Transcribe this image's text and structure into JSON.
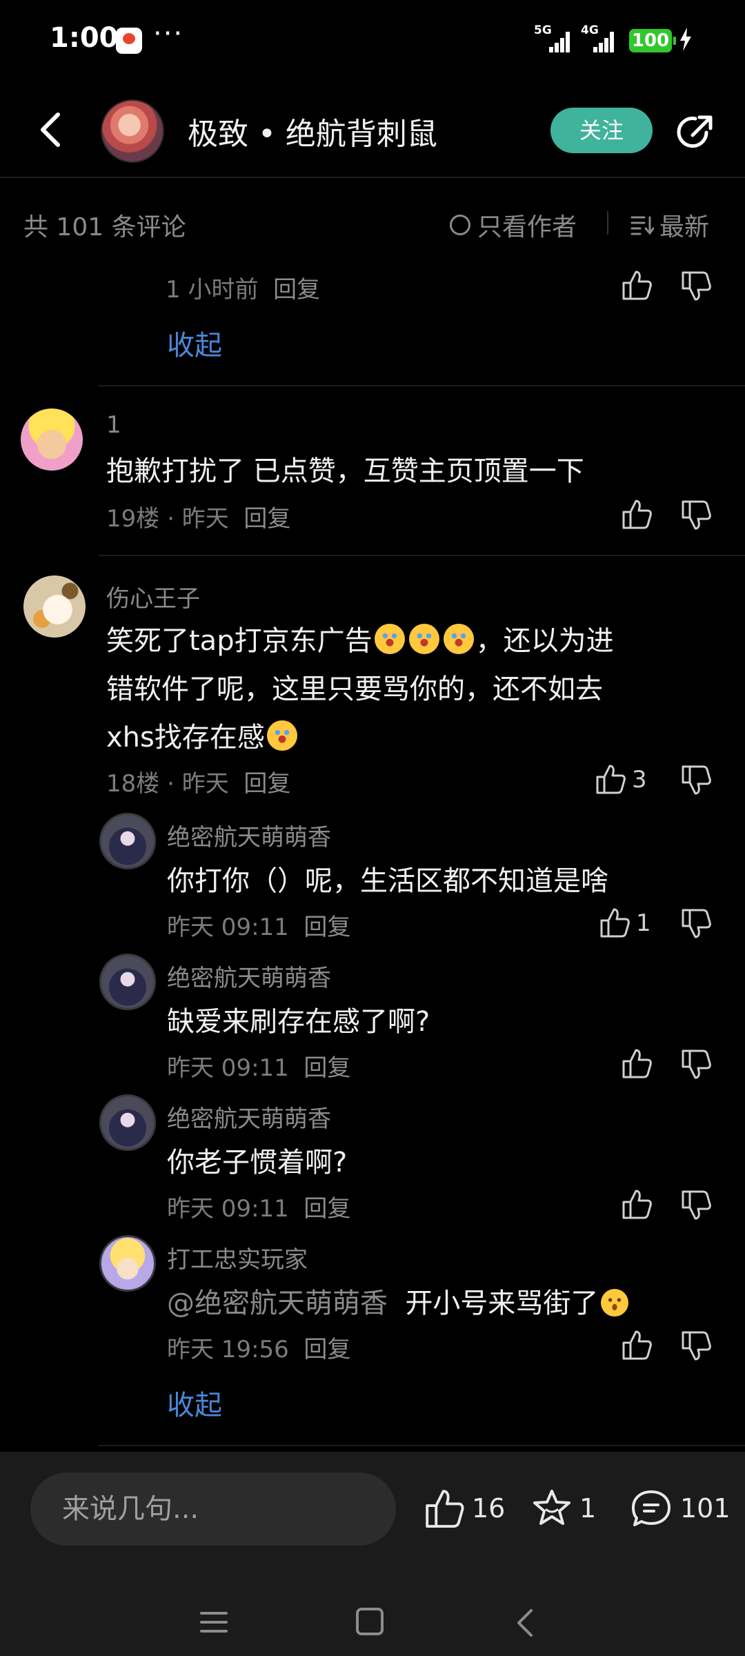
{
  "status_bar": {
    "time": "1:00",
    "dots": "···",
    "net1": "5G",
    "net2": "4G",
    "battery": "100"
  },
  "header": {
    "author_name": "极致 • 绝航背刺鼠",
    "follow_label": "关注"
  },
  "sub_header": {
    "total": "共 101 条评论",
    "author_only": "只看作者",
    "sort": "最新"
  },
  "thread_top": {
    "time": "1 小时前",
    "reply": "回复",
    "collapse": "收起"
  },
  "comments": [
    {
      "username": "1",
      "text": "抱歉打扰了 已点赞，互赞主页顶置一下",
      "floor": "19楼",
      "time": "昨天",
      "reply": "回复"
    },
    {
      "username": "伤心王子",
      "line1a": "笑死了tap打京东广告",
      "line1b": "，还以为进",
      "line2": "错软件了呢，这里只要骂你的，还不如去",
      "line3": "xhs找存在感",
      "floor": "18楼",
      "time": "昨天",
      "reply": "回复",
      "likes": "3",
      "replies": [
        {
          "username": "绝密航天萌萌香",
          "text": "你打你（）呢，生活区都不知道是啥",
          "time": "昨天 09:11",
          "reply": "回复",
          "likes": "1"
        },
        {
          "username": "绝密航天萌萌香",
          "text": "缺爱来刷存在感了啊?",
          "time": "昨天 09:11",
          "reply": "回复"
        },
        {
          "username": "绝密航天萌萌香",
          "text": "你老子惯着啊?",
          "time": "昨天 09:11",
          "reply": "回复"
        },
        {
          "username": "打工忠实玩家",
          "mention": "@绝密航天萌萌香",
          "text": "开小号来骂街了",
          "time": "昨天 19:56",
          "reply": "回复"
        }
      ],
      "collapse": "收起"
    }
  ],
  "bottom_bar": {
    "placeholder": "来说几句...",
    "likes": "16",
    "favorites": "1",
    "comments": "101"
  },
  "icons": [
    "back-icon",
    "share-icon",
    "thumb-up-icon",
    "thumb-down-icon",
    "star-icon",
    "comment-icon",
    "menu-icon",
    "home-icon",
    "nav-back-icon"
  ],
  "colors": {
    "accent_follow": "#3fb39c",
    "link_blue": "#4a86d8",
    "battery_green": "#31c72b",
    "background": "#000000"
  }
}
